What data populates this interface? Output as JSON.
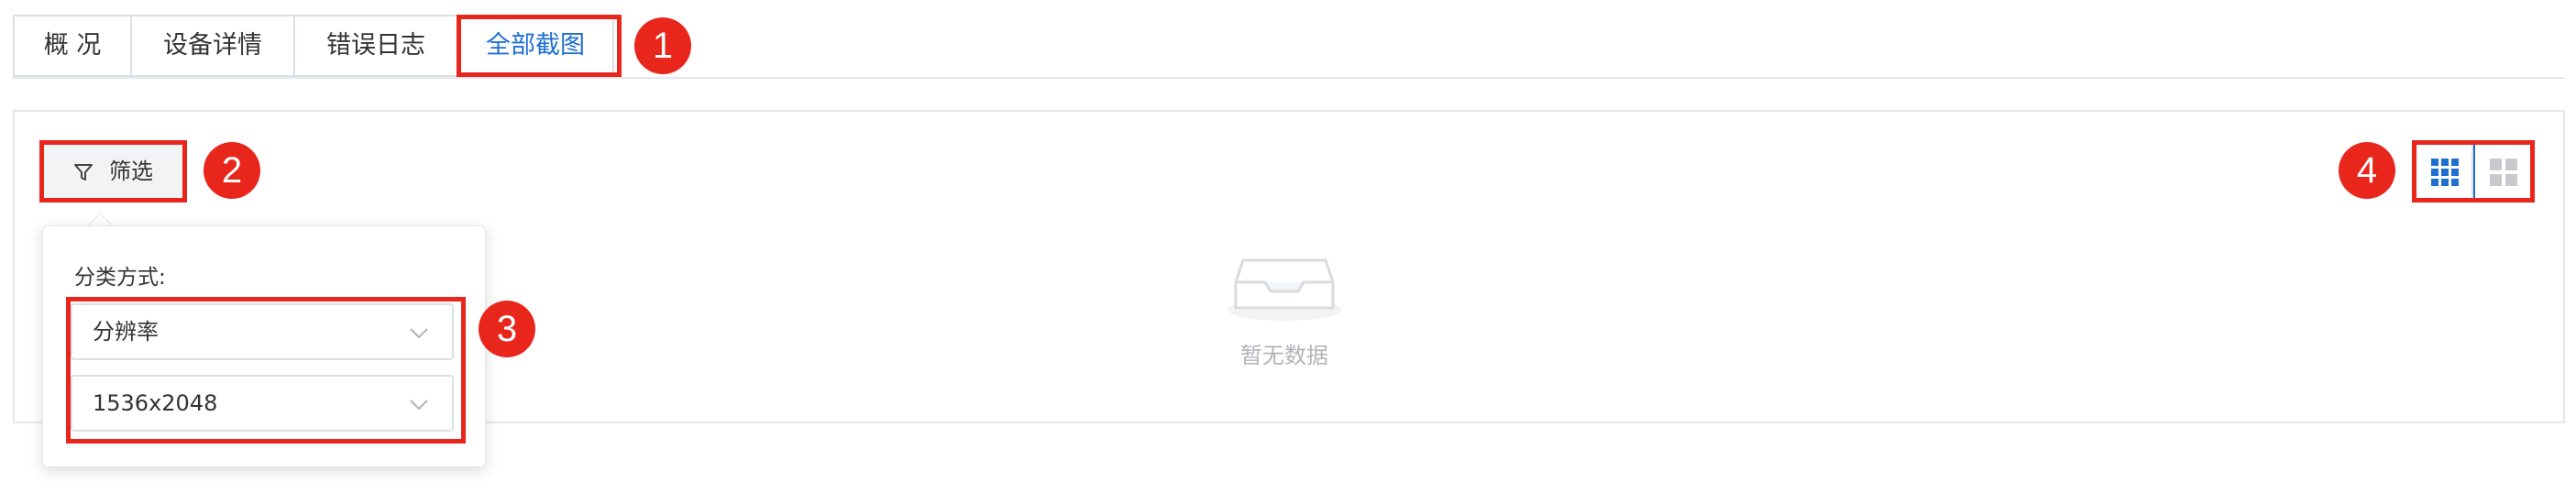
{
  "tabs": [
    {
      "label": "概 况",
      "active": false
    },
    {
      "label": "设备详情",
      "active": false
    },
    {
      "label": "错误日志",
      "active": false
    },
    {
      "label": "全部截图",
      "active": true
    }
  ],
  "filter": {
    "button_label": "筛选",
    "heading": "分类方式:",
    "selects": [
      {
        "value": "分辨率"
      },
      {
        "value": "1536x2048"
      }
    ]
  },
  "empty": {
    "text": "暂无数据"
  },
  "badges": [
    "1",
    "2",
    "3",
    "4"
  ],
  "colors": {
    "accent": "#1f6fd1",
    "annotation": "#e8261c",
    "border": "#dcdfe6",
    "muted_text": "#b0b3b8"
  },
  "icons": {
    "filter": "filter-funnel-icon",
    "chevron": "chevron-down-icon",
    "empty": "empty-inbox-icon",
    "grid_small": "grid-3x3-icon",
    "grid_large": "grid-2x2-icon"
  }
}
